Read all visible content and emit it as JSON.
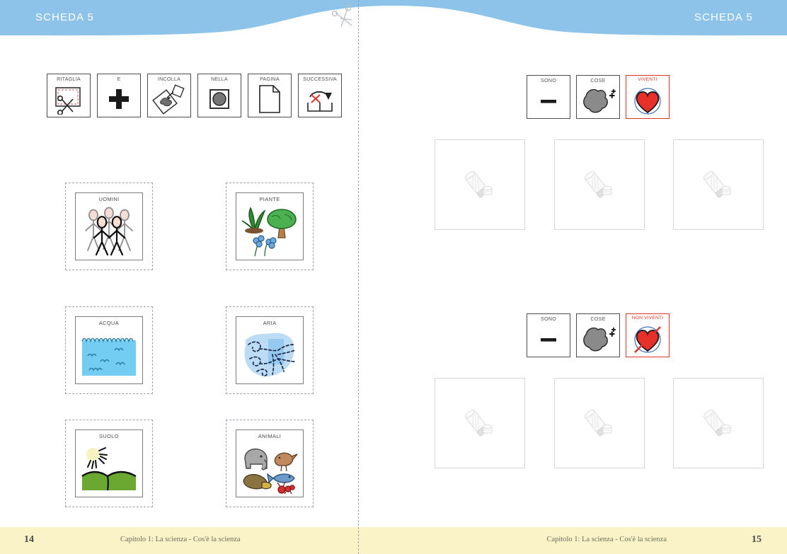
{
  "document": {
    "sheet_label_left": "SCHEDA 5",
    "sheet_label_right": "SCHEDA 5",
    "accent_blue": "#8dc3e8",
    "footer_band": "#faf3c8",
    "red_accent": "#e03127"
  },
  "instructions": {
    "sentence": "RITAGLIA E INCOLLA NELLA PAGINA SUCCESSIVA",
    "cards": [
      {
        "label": "RITAGLIA",
        "icon": "scissors-cut-icon"
      },
      {
        "label": "E",
        "icon": "plus-icon"
      },
      {
        "label": "INCOLLA",
        "icon": "glue-paste-icon"
      },
      {
        "label": "NELLA",
        "icon": "inside-square-icon"
      },
      {
        "label": "PAGINA",
        "icon": "page-sheet-icon"
      },
      {
        "label": "SUCCESSIVA",
        "icon": "next-slot-arrow-icon"
      }
    ]
  },
  "cutout_cards": [
    {
      "label": "UOMINI",
      "icon": "people-figures-icon"
    },
    {
      "label": "PIANTE",
      "icon": "plants-tree-flowers-icon"
    },
    {
      "label": "ACQUA",
      "icon": "water-waves-icon"
    },
    {
      "label": "ARIA",
      "icon": "air-swirls-icon"
    },
    {
      "label": "SUOLO",
      "icon": "soil-sun-hills-icon"
    },
    {
      "label": "ANIMALI",
      "icon": "animals-group-icon"
    }
  ],
  "groups": [
    {
      "sentence": "SONO COSE VIVENTI",
      "cards": [
        {
          "label": "SONO",
          "icon": "dash-copula-icon",
          "red": false
        },
        {
          "label": "COSE",
          "icon": "grey-blob-plural-icon",
          "red": false
        },
        {
          "label": "VIVENTI",
          "icon": "heart-living-icon",
          "red": true
        }
      ],
      "dropzones": [
        {
          "icon": "glue-stick-icon"
        },
        {
          "icon": "glue-stick-icon"
        },
        {
          "icon": "glue-stick-icon"
        }
      ]
    },
    {
      "sentence": "SONO COSE NON VIVENTI",
      "cards": [
        {
          "label": "SONO",
          "icon": "dash-copula-icon",
          "red": false
        },
        {
          "label": "COSE",
          "icon": "grey-blob-plural-icon",
          "red": false
        },
        {
          "label": "NON VIVENTI",
          "icon": "heart-crossed-nonliving-icon",
          "red": true
        }
      ],
      "dropzones": [
        {
          "icon": "glue-stick-icon"
        },
        {
          "icon": "glue-stick-icon"
        },
        {
          "icon": "glue-stick-icon"
        }
      ]
    }
  ],
  "footer": {
    "left_page_number": "14",
    "right_page_number": "15",
    "chapter_text": "Capitolo 1: La scienza - Cos'è la scienza"
  }
}
